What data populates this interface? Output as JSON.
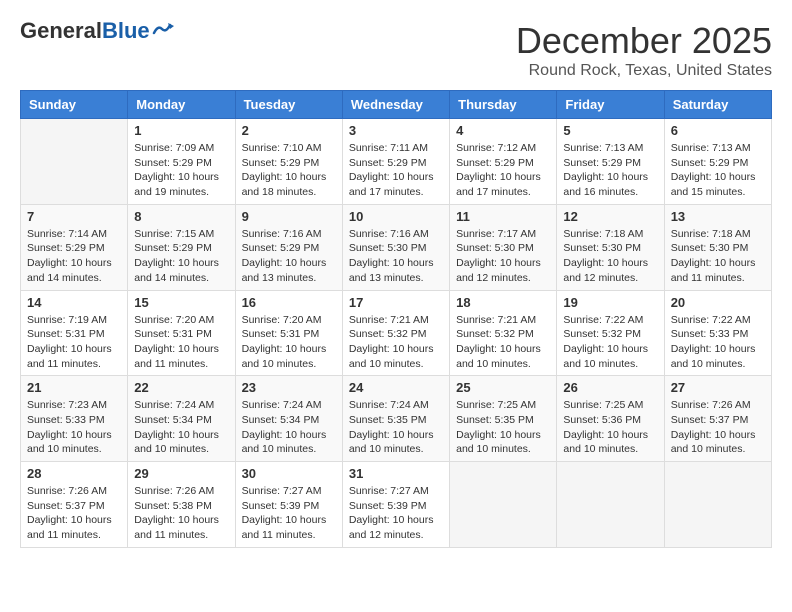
{
  "logo": {
    "general": "General",
    "blue": "Blue"
  },
  "header": {
    "month": "December 2025",
    "location": "Round Rock, Texas, United States"
  },
  "weekdays": [
    "Sunday",
    "Monday",
    "Tuesday",
    "Wednesday",
    "Thursday",
    "Friday",
    "Saturday"
  ],
  "weeks": [
    [
      {
        "day": "",
        "info": ""
      },
      {
        "day": "1",
        "info": "Sunrise: 7:09 AM\nSunset: 5:29 PM\nDaylight: 10 hours\nand 19 minutes."
      },
      {
        "day": "2",
        "info": "Sunrise: 7:10 AM\nSunset: 5:29 PM\nDaylight: 10 hours\nand 18 minutes."
      },
      {
        "day": "3",
        "info": "Sunrise: 7:11 AM\nSunset: 5:29 PM\nDaylight: 10 hours\nand 17 minutes."
      },
      {
        "day": "4",
        "info": "Sunrise: 7:12 AM\nSunset: 5:29 PM\nDaylight: 10 hours\nand 17 minutes."
      },
      {
        "day": "5",
        "info": "Sunrise: 7:13 AM\nSunset: 5:29 PM\nDaylight: 10 hours\nand 16 minutes."
      },
      {
        "day": "6",
        "info": "Sunrise: 7:13 AM\nSunset: 5:29 PM\nDaylight: 10 hours\nand 15 minutes."
      }
    ],
    [
      {
        "day": "7",
        "info": "Sunrise: 7:14 AM\nSunset: 5:29 PM\nDaylight: 10 hours\nand 14 minutes."
      },
      {
        "day": "8",
        "info": "Sunrise: 7:15 AM\nSunset: 5:29 PM\nDaylight: 10 hours\nand 14 minutes."
      },
      {
        "day": "9",
        "info": "Sunrise: 7:16 AM\nSunset: 5:29 PM\nDaylight: 10 hours\nand 13 minutes."
      },
      {
        "day": "10",
        "info": "Sunrise: 7:16 AM\nSunset: 5:30 PM\nDaylight: 10 hours\nand 13 minutes."
      },
      {
        "day": "11",
        "info": "Sunrise: 7:17 AM\nSunset: 5:30 PM\nDaylight: 10 hours\nand 12 minutes."
      },
      {
        "day": "12",
        "info": "Sunrise: 7:18 AM\nSunset: 5:30 PM\nDaylight: 10 hours\nand 12 minutes."
      },
      {
        "day": "13",
        "info": "Sunrise: 7:18 AM\nSunset: 5:30 PM\nDaylight: 10 hours\nand 11 minutes."
      }
    ],
    [
      {
        "day": "14",
        "info": "Sunrise: 7:19 AM\nSunset: 5:31 PM\nDaylight: 10 hours\nand 11 minutes."
      },
      {
        "day": "15",
        "info": "Sunrise: 7:20 AM\nSunset: 5:31 PM\nDaylight: 10 hours\nand 11 minutes."
      },
      {
        "day": "16",
        "info": "Sunrise: 7:20 AM\nSunset: 5:31 PM\nDaylight: 10 hours\nand 10 minutes."
      },
      {
        "day": "17",
        "info": "Sunrise: 7:21 AM\nSunset: 5:32 PM\nDaylight: 10 hours\nand 10 minutes."
      },
      {
        "day": "18",
        "info": "Sunrise: 7:21 AM\nSunset: 5:32 PM\nDaylight: 10 hours\nand 10 minutes."
      },
      {
        "day": "19",
        "info": "Sunrise: 7:22 AM\nSunset: 5:32 PM\nDaylight: 10 hours\nand 10 minutes."
      },
      {
        "day": "20",
        "info": "Sunrise: 7:22 AM\nSunset: 5:33 PM\nDaylight: 10 hours\nand 10 minutes."
      }
    ],
    [
      {
        "day": "21",
        "info": "Sunrise: 7:23 AM\nSunset: 5:33 PM\nDaylight: 10 hours\nand 10 minutes."
      },
      {
        "day": "22",
        "info": "Sunrise: 7:24 AM\nSunset: 5:34 PM\nDaylight: 10 hours\nand 10 minutes."
      },
      {
        "day": "23",
        "info": "Sunrise: 7:24 AM\nSunset: 5:34 PM\nDaylight: 10 hours\nand 10 minutes."
      },
      {
        "day": "24",
        "info": "Sunrise: 7:24 AM\nSunset: 5:35 PM\nDaylight: 10 hours\nand 10 minutes."
      },
      {
        "day": "25",
        "info": "Sunrise: 7:25 AM\nSunset: 5:35 PM\nDaylight: 10 hours\nand 10 minutes."
      },
      {
        "day": "26",
        "info": "Sunrise: 7:25 AM\nSunset: 5:36 PM\nDaylight: 10 hours\nand 10 minutes."
      },
      {
        "day": "27",
        "info": "Sunrise: 7:26 AM\nSunset: 5:37 PM\nDaylight: 10 hours\nand 10 minutes."
      }
    ],
    [
      {
        "day": "28",
        "info": "Sunrise: 7:26 AM\nSunset: 5:37 PM\nDaylight: 10 hours\nand 11 minutes."
      },
      {
        "day": "29",
        "info": "Sunrise: 7:26 AM\nSunset: 5:38 PM\nDaylight: 10 hours\nand 11 minutes."
      },
      {
        "day": "30",
        "info": "Sunrise: 7:27 AM\nSunset: 5:39 PM\nDaylight: 10 hours\nand 11 minutes."
      },
      {
        "day": "31",
        "info": "Sunrise: 7:27 AM\nSunset: 5:39 PM\nDaylight: 10 hours\nand 12 minutes."
      },
      {
        "day": "",
        "info": ""
      },
      {
        "day": "",
        "info": ""
      },
      {
        "day": "",
        "info": ""
      }
    ]
  ]
}
